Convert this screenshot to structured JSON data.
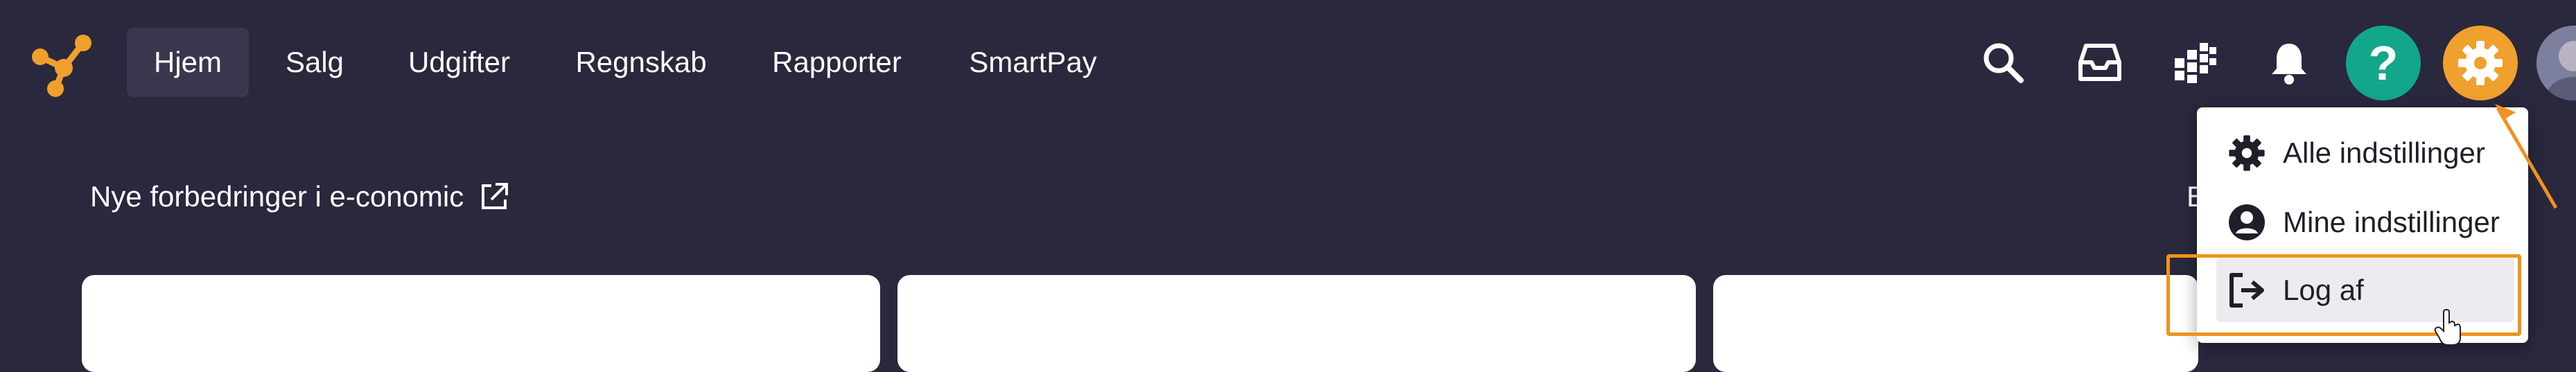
{
  "app": {
    "name": "e-conomic"
  },
  "nav": {
    "items": [
      {
        "label": "Hjem",
        "active": true
      },
      {
        "label": "Salg"
      },
      {
        "label": "Udgifter"
      },
      {
        "label": "Regnskab"
      },
      {
        "label": "Rapporter"
      },
      {
        "label": "SmartPay"
      }
    ]
  },
  "toolbar": {
    "icons": [
      "search-icon",
      "inbox-icon",
      "apps-grid-icon",
      "bell-icon",
      "help-icon",
      "gear-icon",
      "avatar"
    ],
    "help_label": "?"
  },
  "colors": {
    "background": "#29283d",
    "accent_orange": "#f0a02c",
    "help_green": "#12a78a",
    "annotation_orange": "#f0921e"
  },
  "main": {
    "news_link": "Nye forbedringer i e-conomic",
    "partial_label": "E"
  },
  "settings_menu": {
    "items": [
      {
        "label": "Alle indstillinger",
        "icon": "gear-icon"
      },
      {
        "label": "Mine indstillinger",
        "icon": "user-circle-icon"
      },
      {
        "label": "Log af",
        "icon": "logout-icon",
        "highlighted": true
      }
    ]
  }
}
